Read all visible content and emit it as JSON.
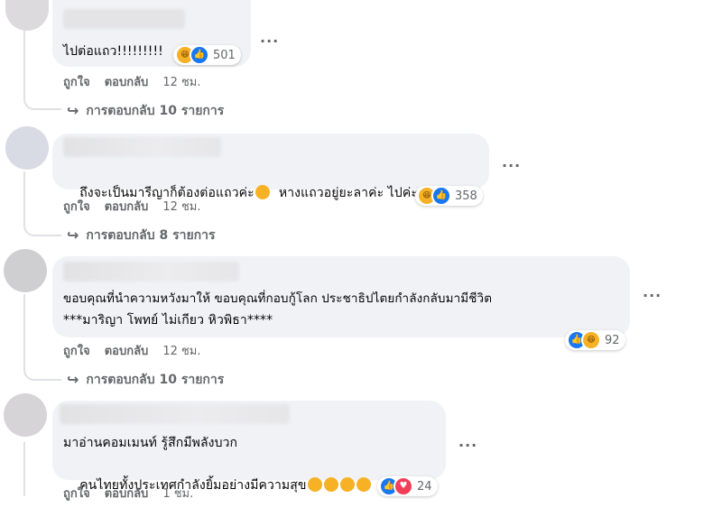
{
  "comments": [
    {
      "text_lines": [
        "ไปต่อแถว!!!!!!!!!"
      ],
      "reactions": {
        "icons": [
          "haha-icon",
          "like-icon"
        ],
        "count": "501"
      },
      "actions": {
        "like": "ถูกใจ",
        "reply": "ตอบกลับ",
        "time": "12 ชม."
      },
      "replies_label": "การตอบกลับ 10 รายการ"
    },
    {
      "text_lines": [
        "ถึงจะเป็นมารีญาก็ต้องต่อแถวค่ะ",
        "หางแถวอยู่ยะลาค่ะ ไปค่ะ"
      ],
      "reactions": {
        "icons": [
          "haha-icon",
          "like-icon"
        ],
        "count": "358"
      },
      "actions": {
        "like": "ถูกใจ",
        "reply": "ตอบกลับ",
        "time": "12 ชม."
      },
      "replies_label": "การตอบกลับ 8 รายการ"
    },
    {
      "text_lines": [
        "ขอบคุณที่นำความหวังมาให้ ขอบคุณที่กอบกู้โลก ประชาธิปไตยกำลังกลับมามีชีวิต",
        "***มาริญา โพทย์ ไม่เกียว หิวพิธา****"
      ],
      "reactions": {
        "icons": [
          "like-icon",
          "haha-icon"
        ],
        "count": "92"
      },
      "actions": {
        "like": "ถูกใจ",
        "reply": "ตอบกลับ",
        "time": "12 ชม."
      },
      "replies_label": "การตอบกลับ 10 รายการ"
    },
    {
      "text_lines": [
        "มาอ่านคอมเมนท์ รู้สึกมีพลังบวก",
        "คนไทยทั้งประเทศกำลังยิ้มอย่างมีความสุข"
      ],
      "reactions": {
        "icons": [
          "like-icon",
          "love-icon"
        ],
        "count": "24"
      },
      "actions": {
        "like": "ถูกใจ",
        "reply": "ตอบกลับ",
        "time": "1 ชม."
      }
    }
  ],
  "more_label": "···",
  "reply_arrow": "↪"
}
